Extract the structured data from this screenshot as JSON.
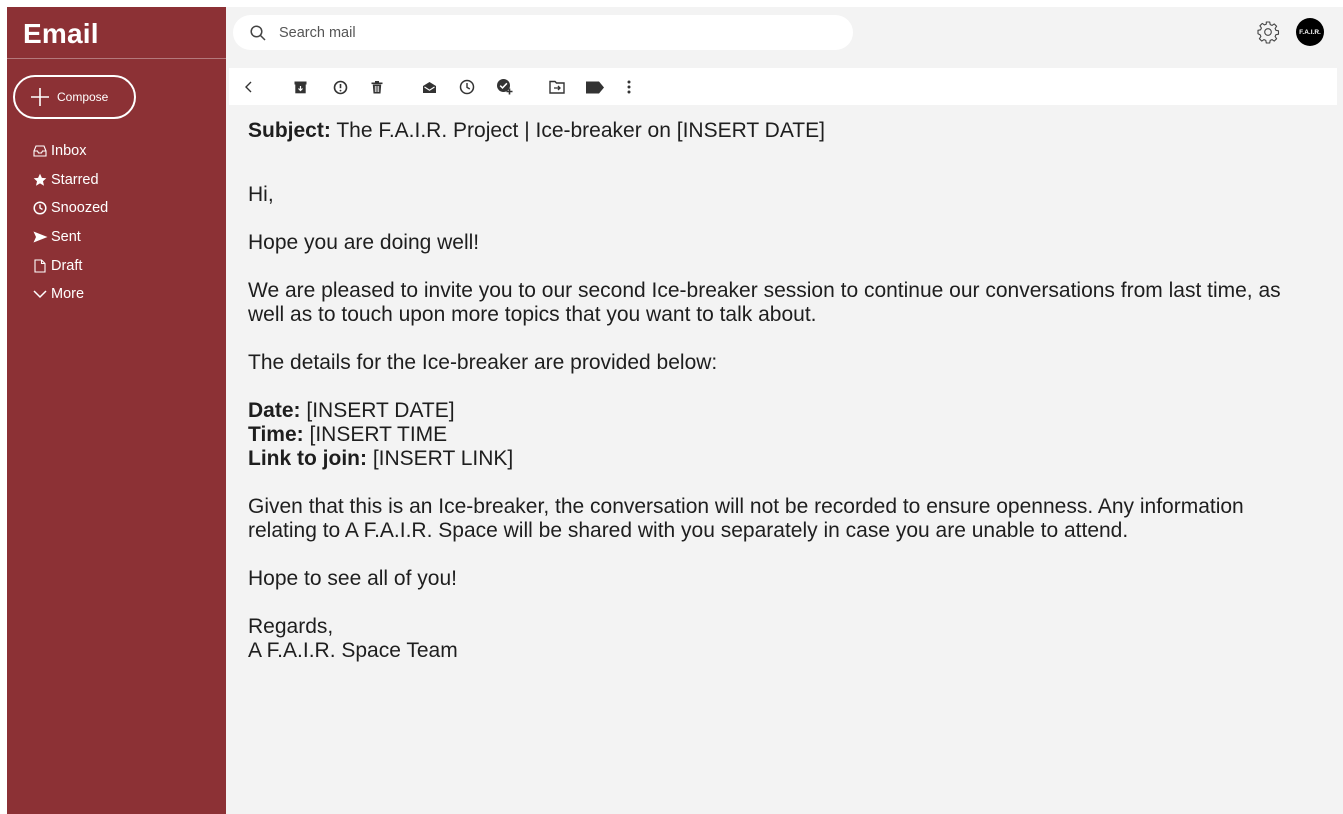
{
  "app": {
    "title": "Email"
  },
  "sidebar": {
    "compose_label": "Compose",
    "items": [
      {
        "label": "Inbox",
        "icon": "inbox-icon"
      },
      {
        "label": "Starred",
        "icon": "star-icon"
      },
      {
        "label": "Snoozed",
        "icon": "clock-icon"
      },
      {
        "label": "Sent",
        "icon": "send-icon"
      },
      {
        "label": "Draft",
        "icon": "draft-icon"
      },
      {
        "label": "More",
        "icon": "chevron-down-icon"
      }
    ]
  },
  "search": {
    "placeholder": "Search mail"
  },
  "header": {
    "avatar_text": "F.A.I.R."
  },
  "toolbar": {
    "icons": [
      "back-icon",
      "archive-icon",
      "report-spam-icon",
      "delete-icon",
      "mark-unread-icon",
      "snooze-icon",
      "add-task-icon",
      "move-to-icon",
      "label-icon",
      "more-options-icon"
    ]
  },
  "email": {
    "subject_label": "Subject:",
    "subject": "The F.A.I.R. Project | Ice-breaker on [INSERT DATE]",
    "greeting": "Hi,",
    "line1": "Hope you are doing well!",
    "para1": "We are pleased to invite you to our second Ice-breaker session to continue our conversations from last time, as well as to touch upon more topics that you want to talk about.",
    "para2": "The details for the Ice-breaker are provided below:",
    "date_label": "Date:",
    "date_value": "[INSERT DATE]",
    "time_label": "Time:",
    "time_value": "[INSERT TIME",
    "link_label": "Link to join:",
    "link_value": "[INSERT LINK]",
    "para3": "Given that this is an Ice-breaker, the conversation will not be recorded to ensure openness. Any information relating to A F.A.I.R. Space will be shared with you separately in case you are unable to attend.",
    "closing": "Hope to see all of you!",
    "signoff": "Regards,",
    "signature": "A F.A.I.R. Space Team"
  },
  "colors": {
    "sidebar": "#8c3135",
    "background": "#f3f3f3"
  }
}
